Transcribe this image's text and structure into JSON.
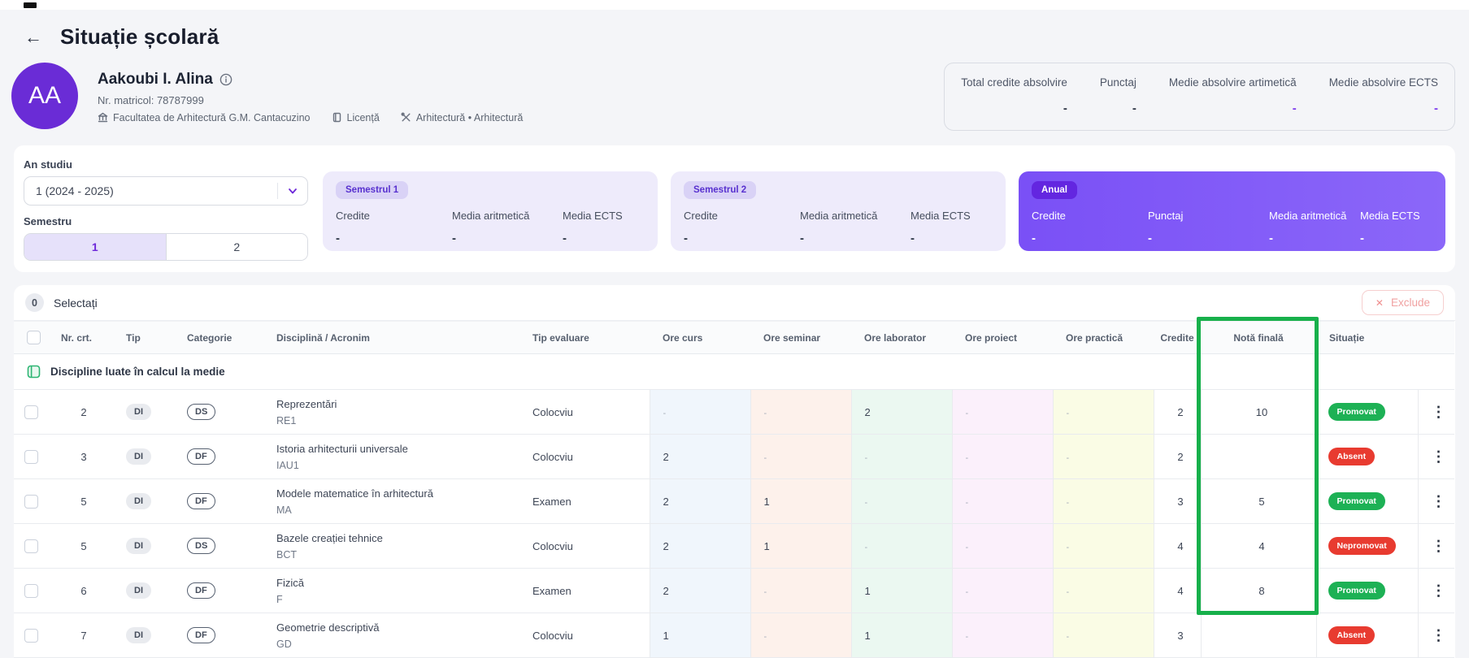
{
  "header": {
    "back_icon": "←",
    "title": "Situație școlară"
  },
  "student": {
    "initials": "AA",
    "name": "Aakoubi I. Alina",
    "matricol_label": "Nr. matricol: 78787999",
    "faculty": "Facultatea de Arhitectură G.M. Cantacuzino",
    "degree": "Licență",
    "program": "Arhitectură • Arhitectură"
  },
  "summary_stats": {
    "items": [
      {
        "label": "Total credite absolvire",
        "value": "-",
        "accent": false
      },
      {
        "label": "Punctaj",
        "value": "-",
        "accent": false
      },
      {
        "label": "Medie absolvire artimetică",
        "value": "-",
        "accent": true
      },
      {
        "label": "Medie absolvire ECTS",
        "value": "-",
        "accent": true
      }
    ]
  },
  "filters": {
    "an_studiu_label": "An studiu",
    "an_studiu_value": "1 (2024 - 2025)",
    "semestru_label": "Semestru",
    "semester_tabs": [
      {
        "label": "1",
        "selected": true
      },
      {
        "label": "2",
        "selected": false
      }
    ]
  },
  "summary_cards": [
    {
      "badge": "Semestrul 1",
      "theme": "light",
      "metrics": [
        {
          "label": "Credite",
          "value": "-"
        },
        {
          "label": "Media aritmetică",
          "value": "-"
        },
        {
          "label": "Media ECTS",
          "value": "-"
        }
      ]
    },
    {
      "badge": "Semestrul 2",
      "theme": "light",
      "metrics": [
        {
          "label": "Credite",
          "value": "-"
        },
        {
          "label": "Media aritmetică",
          "value": "-"
        },
        {
          "label": "Media ECTS",
          "value": "-"
        }
      ]
    },
    {
      "badge": "Anual",
      "theme": "solid",
      "metrics": [
        {
          "label": "Credite",
          "value": "-"
        },
        {
          "label": "Punctaj",
          "value": "-"
        },
        {
          "label": "Media aritmetică",
          "value": "-"
        },
        {
          "label": "Media ECTS",
          "value": "-"
        }
      ]
    }
  ],
  "table": {
    "selected_count": "0",
    "selected_label": "Selectați",
    "exclude_button": {
      "icon": "✕",
      "label": "Exclude"
    },
    "columns": [
      "Nr. crt.",
      "Tip",
      "Categorie",
      "Disciplină / Acronim",
      "Tip evaluare",
      "Ore curs",
      "Ore seminar",
      "Ore laborator",
      "Ore proiect",
      "Ore practică",
      "Credite",
      "Notă finală",
      "Situație"
    ],
    "group_label": "Discipline luate în calcul la medie",
    "menu_icon": "⋮",
    "rows": [
      {
        "nr": "2",
        "tip": "DI",
        "categorie": "DS",
        "disciplina": "Reprezentări",
        "acronim": "RE1",
        "tip_evaluare": "Colocviu",
        "ore_curs": "-",
        "ore_seminar": "-",
        "ore_laborator": "2",
        "ore_proiect": "-",
        "ore_practica": "-",
        "credite": "2",
        "nota": "10",
        "situatie": "Promovat"
      },
      {
        "nr": "3",
        "tip": "DI",
        "categorie": "DF",
        "disciplina": "Istoria arhitecturii universale",
        "acronim": "IAU1",
        "tip_evaluare": "Colocviu",
        "ore_curs": "2",
        "ore_seminar": "-",
        "ore_laborator": "-",
        "ore_proiect": "-",
        "ore_practica": "-",
        "credite": "2",
        "nota": "",
        "situatie": "Absent"
      },
      {
        "nr": "5",
        "tip": "DI",
        "categorie": "DF",
        "disciplina": "Modele matematice în arhitectură",
        "acronim": "MA",
        "tip_evaluare": "Examen",
        "ore_curs": "2",
        "ore_seminar": "1",
        "ore_laborator": "-",
        "ore_proiect": "-",
        "ore_practica": "-",
        "credite": "3",
        "nota": "5",
        "situatie": "Promovat"
      },
      {
        "nr": "5",
        "tip": "DI",
        "categorie": "DS",
        "disciplina": "Bazele creației tehnice",
        "acronim": "BCT",
        "tip_evaluare": "Colocviu",
        "ore_curs": "2",
        "ore_seminar": "1",
        "ore_laborator": "-",
        "ore_proiect": "-",
        "ore_practica": "-",
        "credite": "4",
        "nota": "4",
        "situatie": "Nepromovat"
      },
      {
        "nr": "6",
        "tip": "DI",
        "categorie": "DF",
        "disciplina": "Fizică",
        "acronim": "F",
        "tip_evaluare": "Examen",
        "ore_curs": "2",
        "ore_seminar": "-",
        "ore_laborator": "1",
        "ore_proiect": "-",
        "ore_practica": "-",
        "credite": "4",
        "nota": "8",
        "situatie": "Promovat"
      },
      {
        "nr": "7",
        "tip": "DI",
        "categorie": "DF",
        "disciplina": "Geometrie descriptivă",
        "acronim": "GD",
        "tip_evaluare": "Colocviu",
        "ore_curs": "1",
        "ore_seminar": "-",
        "ore_laborator": "1",
        "ore_proiect": "-",
        "ore_practica": "-",
        "credite": "3",
        "nota": "",
        "situatie": "Absent"
      }
    ]
  },
  "annotation": {
    "type": "rectangle",
    "column": "Notă finală",
    "color": "#17b04b"
  },
  "colors": {
    "accent_purple": "#6d28d9",
    "status": {
      "Promovat": "#1db155",
      "Nepromovat": "#e83b30",
      "Absent": "#e83b30"
    },
    "column_backgrounds": {
      "ore_curs": "#f0f6fc",
      "ore_seminar": "#fdf1eb",
      "ore_laborator": "#ebf8f1",
      "ore_proiect": "#fbf0fb",
      "ore_practica": "#fafce5"
    }
  }
}
